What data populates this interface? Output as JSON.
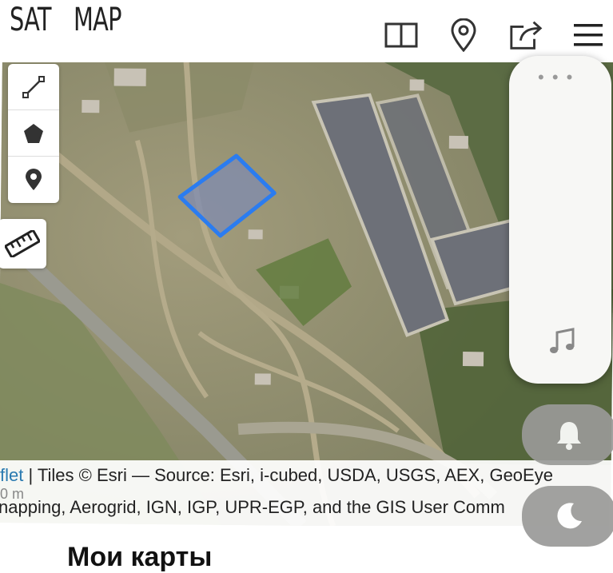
{
  "header": {
    "brand_sat": "SAT",
    "brand_map": "MAP",
    "icons": [
      "book-open-icon",
      "location-pin-icon",
      "share-icon",
      "hamburger-menu-icon"
    ]
  },
  "tools": [
    "draw-line-icon",
    "draw-polygon-icon",
    "place-marker-icon"
  ],
  "ruler_icon": "ruler-icon",
  "panel": {
    "icon": "music-note-icon"
  },
  "buttons": [
    "bell-icon",
    "moon-icon"
  ],
  "attribution": {
    "line1_link": "flet",
    "line1_text": " | Tiles © Esri — Source: Esri, i-cubed, USDA, USGS, AEX, GeoEye",
    "line2_text": "napping, Aerogrid, IGN, IGP, UPR-EGP, and the GIS User Comm"
  },
  "scale_label": "0 m",
  "bottom": {
    "title": "Мои карты"
  },
  "colors": {
    "polygon": "#2b7cf0",
    "link": "#2a7ab0"
  }
}
